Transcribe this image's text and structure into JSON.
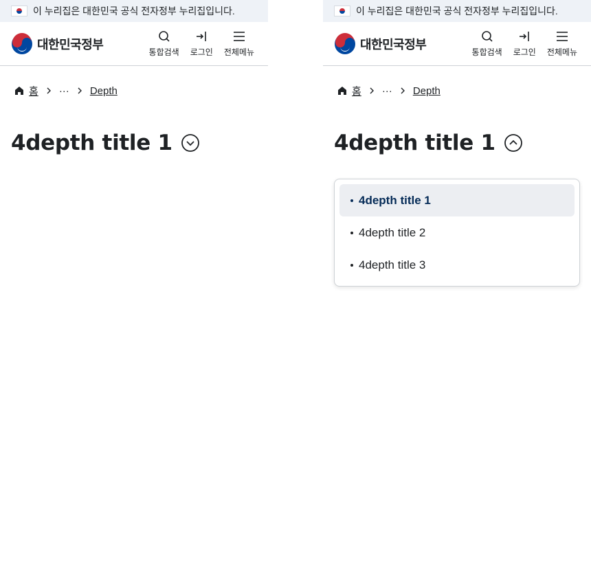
{
  "banner": {
    "text": "이 누리집은 대한민국 공식 전자정부 누리집입니다."
  },
  "logo": {
    "text": "대한민국정부"
  },
  "utility": {
    "search": "통합검색",
    "login": "로그인",
    "menu": "전체메뉴"
  },
  "breadcrumb": {
    "home": "홈",
    "ellipsis": "···",
    "current": "Depth"
  },
  "title": "4depth title 1",
  "dropdown": {
    "items": [
      "4depth title 1",
      "4depth title 2",
      "4depth title 3"
    ],
    "selected_index": 0
  },
  "colors": {
    "banner_bg": "#eef2f7",
    "active_item_bg": "#eceef2",
    "active_item_text": "#052b57",
    "logo_red": "#cd2e3a",
    "logo_blue": "#0047a0"
  }
}
